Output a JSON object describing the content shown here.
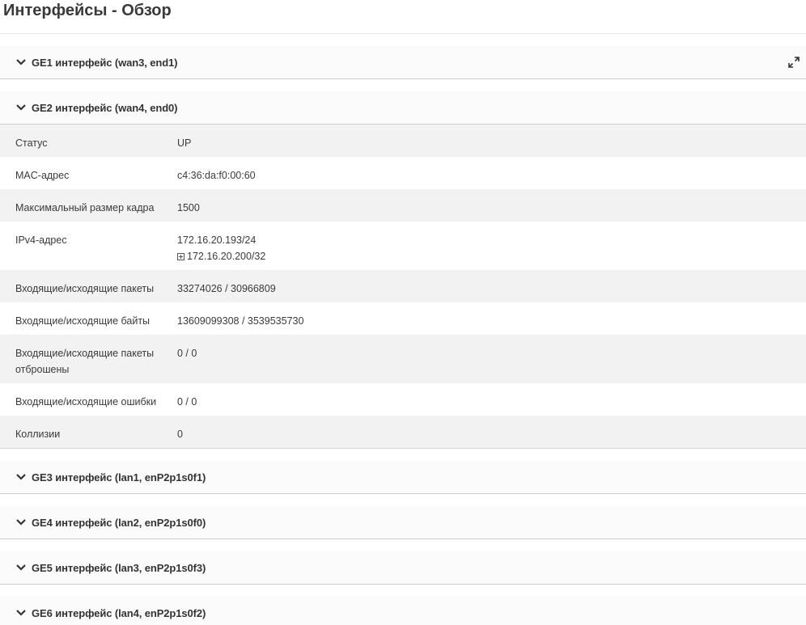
{
  "page": {
    "title": "Интерфейсы - Обзор"
  },
  "interfaces": [
    {
      "label": "GE1 интерфейс (wan3, end1)"
    },
    {
      "label": "GE2 интерфейс (wan4, end0)"
    },
    {
      "label": "GE3 интерфейс (lan1, enP2p1s0f1)"
    },
    {
      "label": "GE4 интерфейс (lan2, enP2p1s0f0)"
    },
    {
      "label": "GE5 интерфейс (lan3, enP2p1s0f3)"
    },
    {
      "label": "GE6 интерфейс (lan4, enP2p1s0f2)"
    }
  ],
  "ge2_details": {
    "status_label": "Статус",
    "status_value": "UP",
    "mac_label": "MAC-адрес",
    "mac_value": "c4:36:da:f0:00:60",
    "mtu_label": "Максимальный размер кадра",
    "mtu_value": "1500",
    "ipv4_label": "IPv4-адрес",
    "ipv4_primary": "172.16.20.193/24",
    "ipv4_extra": "172.16.20.200/32",
    "packets_label": "Входящие/исходящие пакеты",
    "packets_value": "33274026 / 30966809",
    "bytes_label": "Входящие/исходящие байты",
    "bytes_value": "13609099308 / 3539535730",
    "dropped_label": "Входящие/исходящие пакеты отброшены",
    "dropped_value": "0 / 0",
    "errors_label": "Входящие/исходящие ошибки",
    "errors_value": "0 / 0",
    "collisions_label": "Коллизии",
    "collisions_value": "0"
  },
  "icons": {
    "chevron": "chevron-down-icon",
    "expand": "expand-icon",
    "plus": "plus-square-icon"
  }
}
